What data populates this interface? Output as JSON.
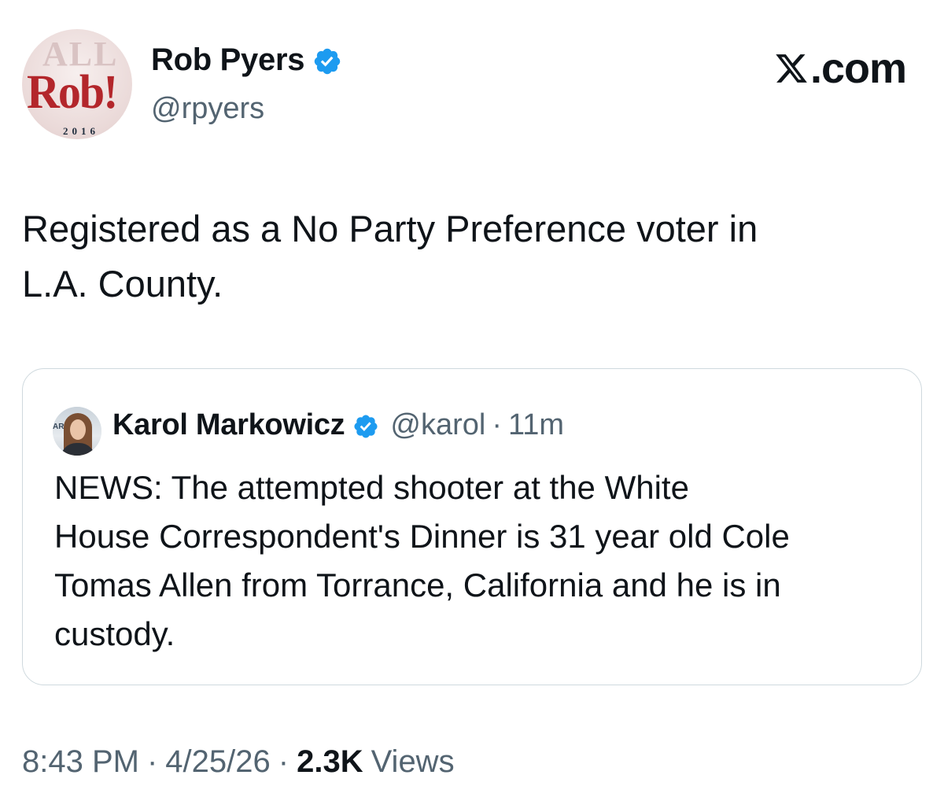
{
  "header": {
    "display_name": "Rob Pyers",
    "handle": "@rpyers",
    "avatar": {
      "main_text": "Rob!",
      "year_text": "2016",
      "bg_text": "ALL"
    },
    "site_label": ".com",
    "site_logo": "x-logo-icon"
  },
  "tweet": {
    "text": "Registered as a No Party Preference voter in\nL.A. County."
  },
  "quote": {
    "display_name": "Karol Markowicz",
    "handle": "@karol",
    "separator": "·",
    "time": "11m",
    "avatar_tag": "AR",
    "text": "NEWS: The attempted shooter at the White\nHouse Correspondent's Dinner is 31 year old Cole\nTomas Allen from Torrance, California and he is in\ncustody."
  },
  "footer": {
    "time": "8:43 PM",
    "date": "4/25/26",
    "views_count": "2.3K",
    "views_label": "Views",
    "separator": "·"
  },
  "colors": {
    "verified": "#1d9bf0",
    "text_primary": "#0f1419",
    "text_secondary": "#536471",
    "border": "#cfd9de",
    "avatar_red": "#b3262b"
  }
}
